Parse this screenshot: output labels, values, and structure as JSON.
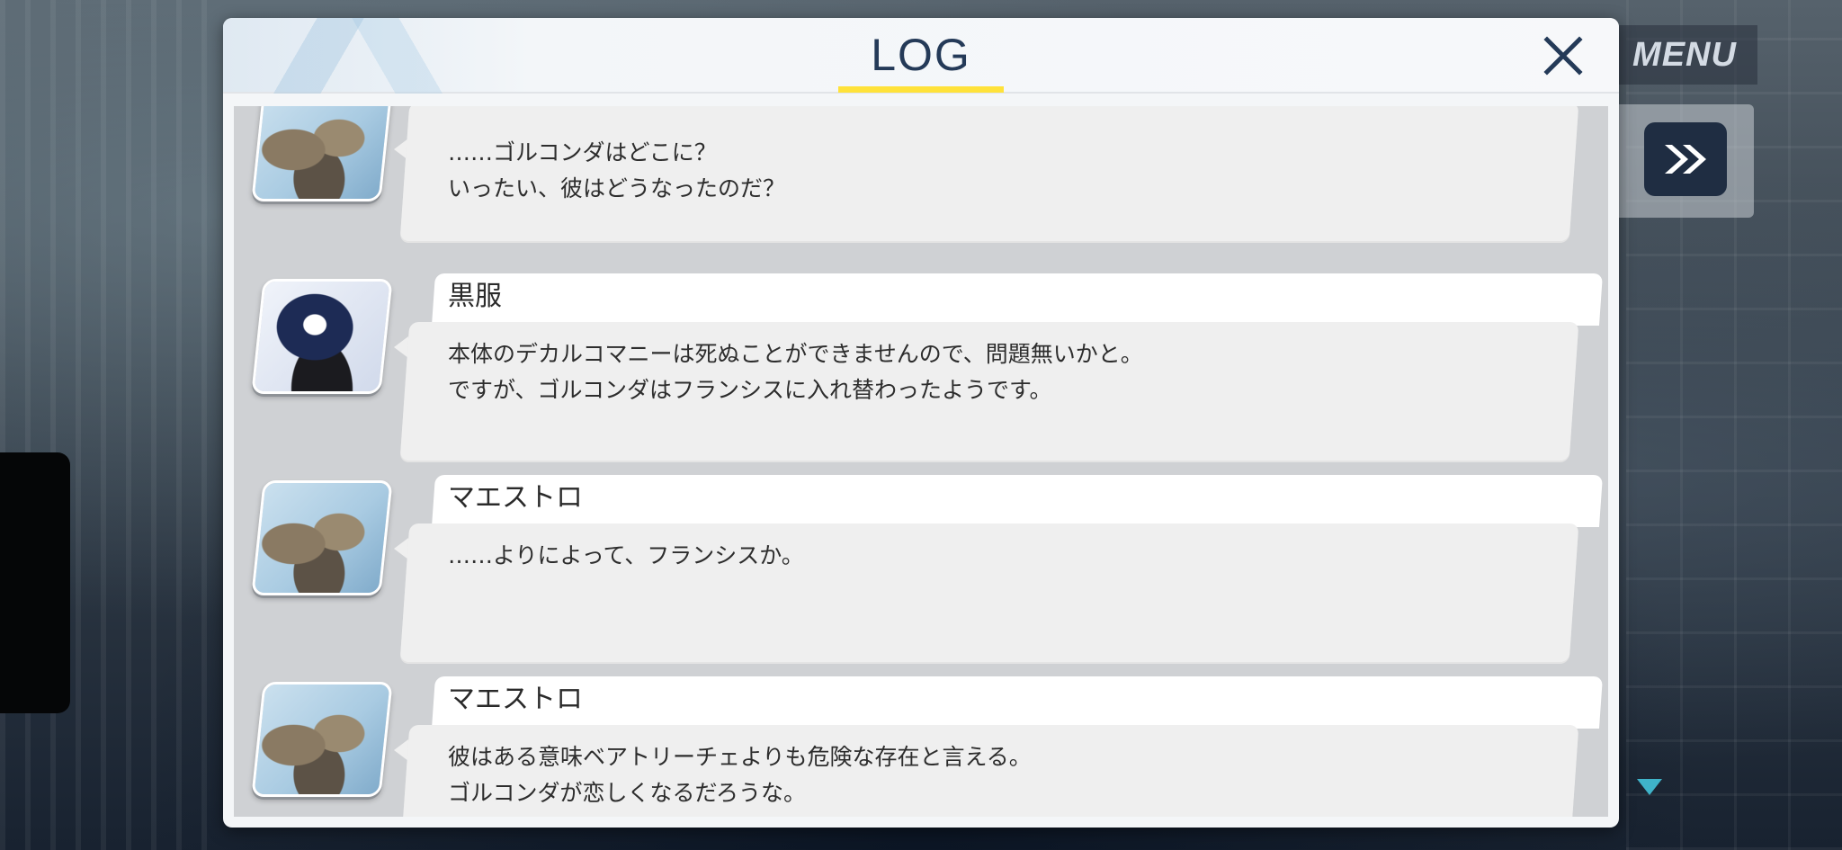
{
  "hud": {
    "menu_label": "MENU"
  },
  "log": {
    "title": "LOG",
    "entries": [
      {
        "speaker": "",
        "lines": [
          "……ゴルコンダはどこに？",
          "いったい、彼はどうなったのだ？"
        ]
      },
      {
        "speaker": "黒服",
        "lines": [
          "本体のデカルコマニーは死ぬことができませんので、問題無いかと。",
          "ですが、ゴルコンダはフランシスに入れ替わったようです。"
        ]
      },
      {
        "speaker": "マエストロ",
        "lines": [
          "……よりによって、フランシスか。"
        ]
      },
      {
        "speaker": "マエストロ",
        "lines": [
          "彼はある意味ベアトリーチェよりも危険な存在と言える。",
          "ゴルコンダが恋しくなるだろうな。"
        ]
      }
    ]
  },
  "colors": {
    "title_text": "#243a58",
    "title_underline": "#ffe23a",
    "skip_button": "#1f2d42"
  },
  "icons": [
    "close-icon",
    "fast-forward-icon",
    "scroll-down-icon"
  ]
}
